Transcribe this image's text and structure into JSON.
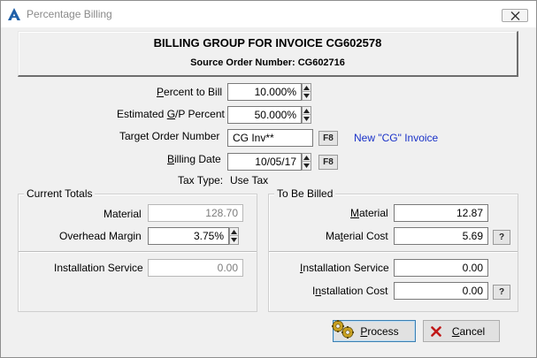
{
  "window": {
    "title": "Percentage Billing",
    "close_label": "close"
  },
  "header": {
    "title": "BILLING GROUP FOR INVOICE CG602578",
    "subtitle": "Source Order Number: CG602716"
  },
  "form": {
    "percent_to_bill": {
      "label_pre": "",
      "label_ul": "P",
      "label_post": "ercent to Bill",
      "value": "10.000%"
    },
    "estimated_gp": {
      "label_pre": "Estimated ",
      "label_ul": "G",
      "label_post": "/P Percent",
      "value": "50.000%"
    },
    "target_order": {
      "label": "Target Order Number",
      "value": "CG Inv**",
      "f8": "F8",
      "link": "New \"CG\" Invoice"
    },
    "billing_date": {
      "label_pre": "",
      "label_ul": "B",
      "label_post": "illing Date",
      "value": "10/05/17",
      "f8": "F8"
    },
    "tax_type": {
      "label": "Tax Type:",
      "value": "Use Tax"
    }
  },
  "current_totals": {
    "title": "Current Totals",
    "material": {
      "label": "Material",
      "value": "128.70"
    },
    "overhead_margin": {
      "label": "Overhead Margin",
      "value": "3.75%"
    },
    "installation_service": {
      "label": "Installation Service",
      "value": "0.00"
    }
  },
  "to_be_billed": {
    "title": "To Be Billed",
    "material": {
      "label_pre": "",
      "label_ul": "M",
      "label_post": "aterial",
      "value": "12.87"
    },
    "material_cost": {
      "label_pre": "Ma",
      "label_ul": "t",
      "label_post": "erial Cost",
      "value": "5.69",
      "help": "?"
    },
    "installation_service": {
      "label_pre": "",
      "label_ul": "I",
      "label_post": "nstallation Service",
      "value": "0.00"
    },
    "installation_cost": {
      "label_pre": "I",
      "label_ul": "n",
      "label_post": "stallation Cost",
      "value": "0.00",
      "help": "?"
    }
  },
  "buttons": {
    "process": {
      "label_pre": "",
      "label_ul": "P",
      "label_post": "rocess"
    },
    "cancel": {
      "label_pre": "",
      "label_ul": "C",
      "label_post": "ancel"
    }
  },
  "colors": {
    "link": "#1a32c8",
    "cancel_icon": "#c01818",
    "app_icon": "#1f5fa8"
  }
}
